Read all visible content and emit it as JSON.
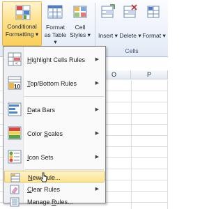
{
  "ribbon": {
    "conditional_formatting": {
      "line1": "Conditional",
      "line2": "Formatting",
      "arrow": "▾"
    },
    "format_as_table": {
      "line1": "Format",
      "line2": "as Table",
      "arrow": "▾"
    },
    "cell_styles": {
      "line1": "Cell",
      "line2": "Styles",
      "arrow": "▾"
    },
    "insert": {
      "label": "Insert",
      "arrow": "▾"
    },
    "delete": {
      "label": "Delete",
      "arrow": "▾"
    },
    "format": {
      "label": "Format",
      "arrow": "▾"
    },
    "group_label": "Cells"
  },
  "sheet": {
    "columns": [
      "O",
      "P"
    ]
  },
  "menu": {
    "items": [
      {
        "label_pre": "",
        "accel": "H",
        "label_post": "ighlight Cells Rules",
        "icon": "highlight-cells-icon",
        "submenu": true
      },
      {
        "label_pre": "",
        "accel": "T",
        "label_post": "op/Bottom Rules",
        "icon": "top-bottom-10-icon",
        "submenu": true
      },
      {
        "label_pre": "",
        "accel": "D",
        "label_post": "ata Bars",
        "icon": "data-bars-icon",
        "submenu": true
      },
      {
        "label_pre": "Color ",
        "accel": "S",
        "label_post": "cales",
        "icon": "color-scales-icon",
        "submenu": true
      },
      {
        "label_pre": "",
        "accel": "I",
        "label_post": "con Sets",
        "icon": "icon-sets-icon",
        "submenu": true
      },
      {
        "label_pre": "",
        "accel": "N",
        "label_post": "ew Rule...",
        "icon": "new-rule-icon",
        "submenu": false,
        "highlighted": true
      },
      {
        "label_pre": "",
        "accel": "C",
        "label_post": "lear Rules",
        "icon": "clear-rules-icon",
        "submenu": true
      },
      {
        "label_pre": "Manage ",
        "accel": "R",
        "label_post": "ules...",
        "icon": "manage-rules-icon",
        "submenu": false
      }
    ],
    "submenu_arrow": "▶"
  },
  "colors": {
    "highlight": "#fde38e",
    "ribbon_bg": "#eef3fa",
    "menu_border": "#868686"
  }
}
